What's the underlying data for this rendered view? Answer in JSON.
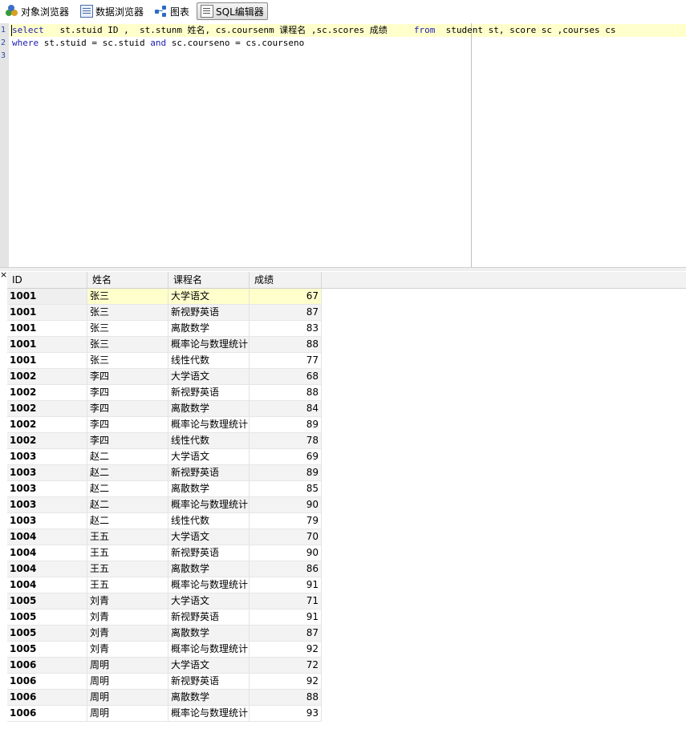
{
  "toolbar": {
    "items": [
      {
        "label": "对象浏览器",
        "icon": "object-browser-icon"
      },
      {
        "label": "数据浏览器",
        "icon": "data-browser-icon"
      },
      {
        "label": "图表",
        "icon": "chart-icon"
      },
      {
        "label": "SQL编辑器",
        "icon": "sql-editor-icon",
        "active": true
      }
    ]
  },
  "editor": {
    "line_numbers": [
      "1",
      "2",
      "3"
    ],
    "lines": [
      [
        {
          "t": "select",
          "kw": true
        },
        {
          "t": "   st.stuid ID ,  st.stunm 姓名, cs.coursenm 课程名 ,sc.scores 成绩     ",
          "kw": false
        },
        {
          "t": "from",
          "kw": true
        },
        {
          "t": "  student st, score sc ,courses cs",
          "kw": false
        }
      ],
      [
        {
          "t": "where",
          "kw": true
        },
        {
          "t": " st.stuid = sc.stuid ",
          "kw": false
        },
        {
          "t": "and",
          "kw": true
        },
        {
          "t": " sc.courseno = cs.courseno",
          "kw": false
        }
      ],
      []
    ]
  },
  "grid": {
    "columns": [
      "ID",
      "姓名",
      "课程名",
      "成绩"
    ],
    "rows": [
      [
        "1001",
        "张三",
        "大学语文",
        "67"
      ],
      [
        "1001",
        "张三",
        "新视野英语",
        "87"
      ],
      [
        "1001",
        "张三",
        "离散数学",
        "83"
      ],
      [
        "1001",
        "张三",
        "概率论与数理统计",
        "88"
      ],
      [
        "1001",
        "张三",
        "线性代数",
        "77"
      ],
      [
        "1002",
        "李四",
        "大学语文",
        "68"
      ],
      [
        "1002",
        "李四",
        "新视野英语",
        "88"
      ],
      [
        "1002",
        "李四",
        "离散数学",
        "84"
      ],
      [
        "1002",
        "李四",
        "概率论与数理统计",
        "89"
      ],
      [
        "1002",
        "李四",
        "线性代数",
        "78"
      ],
      [
        "1003",
        "赵二",
        "大学语文",
        "69"
      ],
      [
        "1003",
        "赵二",
        "新视野英语",
        "89"
      ],
      [
        "1003",
        "赵二",
        "离散数学",
        "85"
      ],
      [
        "1003",
        "赵二",
        "概率论与数理统计",
        "90"
      ],
      [
        "1003",
        "赵二",
        "线性代数",
        "79"
      ],
      [
        "1004",
        "王五",
        "大学语文",
        "70"
      ],
      [
        "1004",
        "王五",
        "新视野英语",
        "90"
      ],
      [
        "1004",
        "王五",
        "离散数学",
        "86"
      ],
      [
        "1004",
        "王五",
        "概率论与数理统计",
        "91"
      ],
      [
        "1005",
        "刘青",
        "大学语文",
        "71"
      ],
      [
        "1005",
        "刘青",
        "新视野英语",
        "91"
      ],
      [
        "1005",
        "刘青",
        "离散数学",
        "87"
      ],
      [
        "1005",
        "刘青",
        "概率论与数理统计",
        "92"
      ],
      [
        "1006",
        "周明",
        "大学语文",
        "72"
      ],
      [
        "1006",
        "周明",
        "新视野英语",
        "92"
      ],
      [
        "1006",
        "周明",
        "离散数学",
        "88"
      ],
      [
        "1006",
        "周明",
        "概率论与数理统计",
        "93"
      ]
    ]
  },
  "colors": {
    "keyword": "#1c1cb0",
    "current_line": "#ffffcc",
    "gutter": "#e4e4e4"
  }
}
